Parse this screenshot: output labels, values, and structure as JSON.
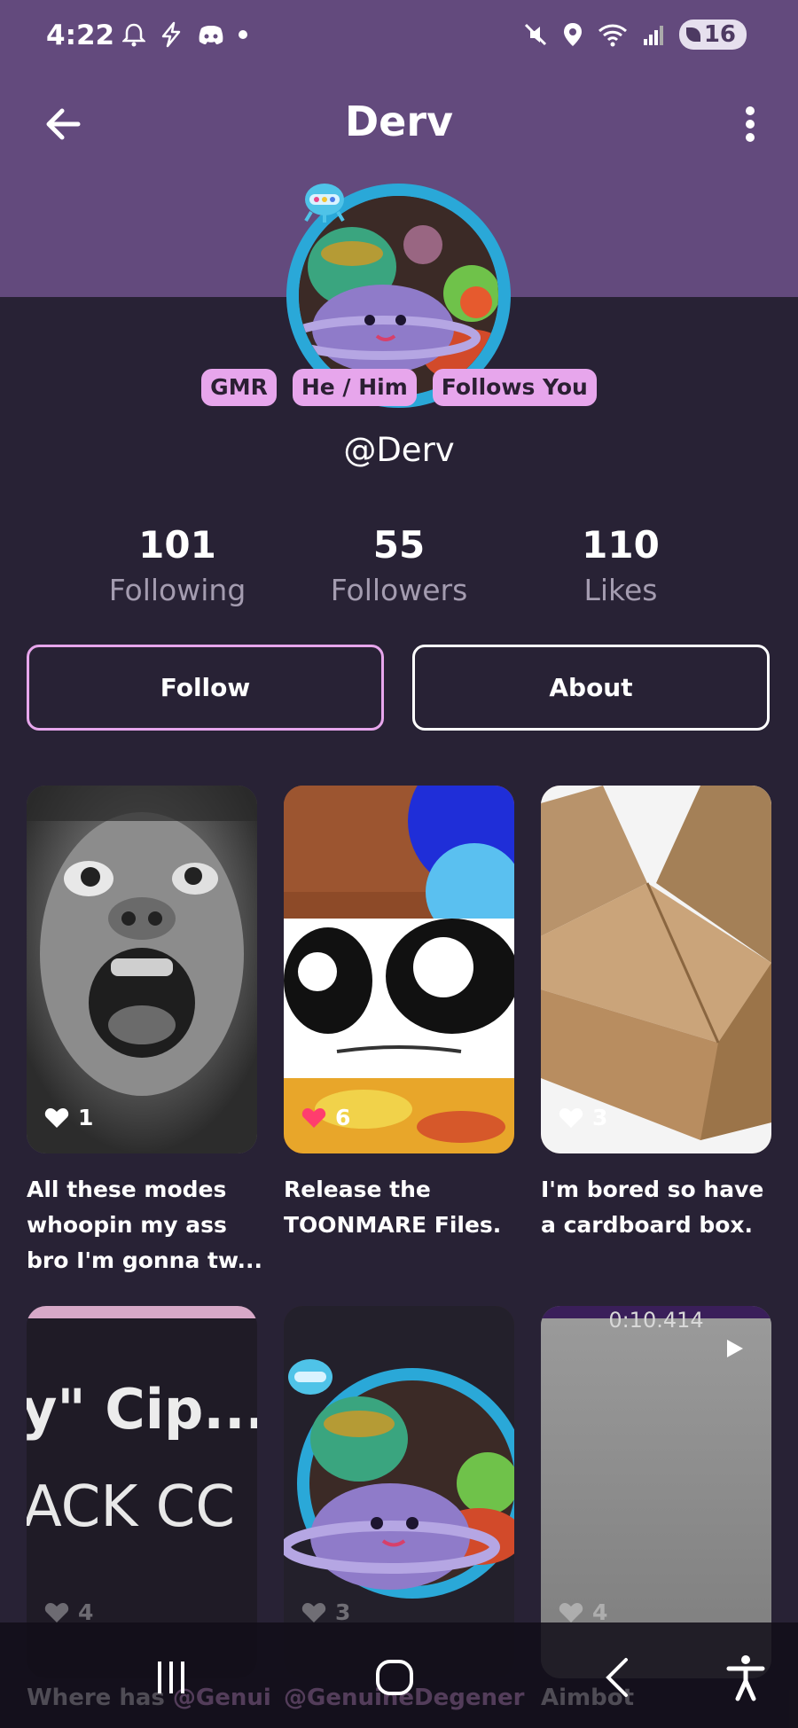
{
  "status_bar": {
    "time": "4:22",
    "battery": "16",
    "icons_left": [
      "bell-icon",
      "bolt-icon",
      "discord-icon",
      "dot-icon"
    ],
    "icons_right": [
      "mute-icon",
      "location-icon",
      "wifi-icon",
      "signal-icon"
    ]
  },
  "app_bar": {
    "title": "Derv",
    "back_icon": "arrow-left-icon",
    "menu_icon": "more-vert-icon"
  },
  "profile": {
    "tags": [
      "GMR",
      "He / Him",
      "Follows You"
    ],
    "handle": "@Derv",
    "stats": [
      {
        "value": "101",
        "label": "Following"
      },
      {
        "value": "55",
        "label": "Followers"
      },
      {
        "value": "110",
        "label": "Likes"
      }
    ]
  },
  "actions": {
    "follow_label": "Follow",
    "about_label": "About"
  },
  "posts": [
    {
      "likes": "1",
      "liked": false,
      "caption": "All these modes whoopin my ass bro I'm gonna tw..."
    },
    {
      "likes": "6",
      "liked": true,
      "caption": "Release the TOONMARE Files."
    },
    {
      "likes": "3",
      "liked": false,
      "caption": "I'm bored so have a cardboard box."
    },
    {
      "likes": "4",
      "liked": false,
      "text_overlay_1": "y\" Cip...",
      "text_overlay_2": "ACK CC",
      "caption_prefix": "Where has ",
      "caption_mention": "@Genui"
    },
    {
      "likes": "3",
      "liked": false,
      "caption": "@GenuineDegener"
    },
    {
      "likes": "4",
      "liked": false,
      "timer": "0:10.414",
      "caption": "Aimbot"
    }
  ],
  "colors": {
    "header": "#634a7d",
    "background": "#282235",
    "accent": "#e7a6ec",
    "like_active": "#ff3d6e"
  }
}
